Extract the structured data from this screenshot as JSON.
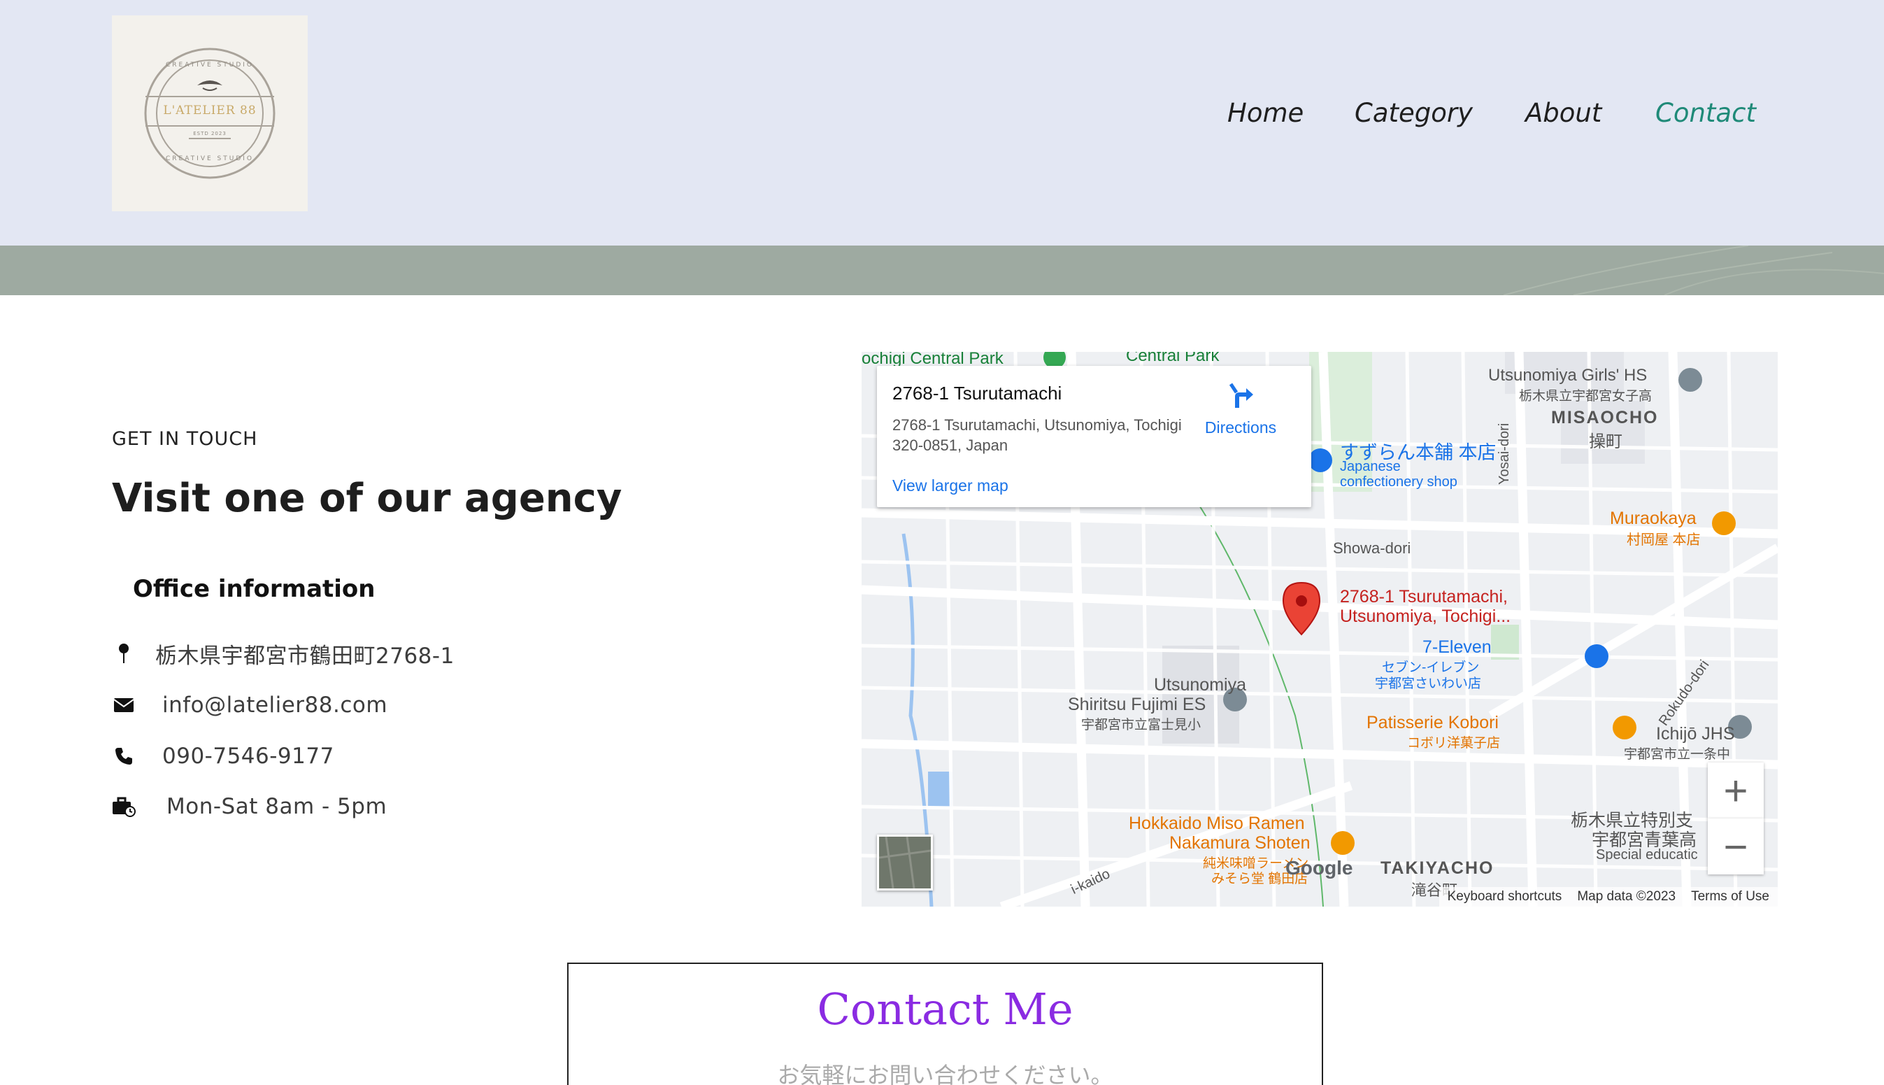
{
  "header": {
    "logo": {
      "top_text": "CREATIVE STUDIO",
      "name": "L'ATELIER 88",
      "est": "ESTD 2023",
      "bottom_text": "CREATIVE STUDIO"
    },
    "nav": [
      {
        "label": "Home",
        "active": false
      },
      {
        "label": "Category",
        "active": false
      },
      {
        "label": "About",
        "active": false
      },
      {
        "label": "Contact",
        "active": true
      }
    ],
    "accent_color": "#1f8a78"
  },
  "contact_section": {
    "eyebrow": "GET IN TOUCH",
    "heading": "Visit one of our agency",
    "subheading": "Office information",
    "items": [
      {
        "icon": "map-pin-icon",
        "text": "栃木県宇都宮市鶴田町2768-1"
      },
      {
        "icon": "envelope-icon",
        "text": "info@latelier88.com"
      },
      {
        "icon": "phone-icon",
        "text": "090-7546-9177"
      },
      {
        "icon": "briefcase-clock-icon",
        "text": "Mon-Sat 8am - 5pm"
      }
    ]
  },
  "map": {
    "card": {
      "title": "2768-1 Tsurutamachi",
      "address": "2768-1 Tsurutamachi, Utsunomiya, Tochigi 320-0851, Japan",
      "directions": "Directions",
      "larger_map": "View larger map"
    },
    "pin_label_1": "2768-1 Tsurutamachi,",
    "pin_label_2": "Utsunomiya, Tochigi...",
    "places": {
      "central_park_left": "ochigi Central Park",
      "central_park": "Central Park",
      "girls_hs": "Utsunomiya Girls' HS",
      "girls_hs_jp": "栃木県立宇都宮女子高",
      "misaocho": "MISAOCHO",
      "misaocho_jp": "操町",
      "suzuran": "すずらん本舗 本店",
      "suzuran_sub1": "Japanese",
      "suzuran_sub2": "confectionery shop",
      "yosai": "Yosai-dori",
      "muraokaya": "Muraokaya",
      "muraokaya_jp": "村岡屋 本店",
      "showa": "Showa-dori",
      "seven": "7-Eleven",
      "seven_jp1": "セブン-イレブン",
      "seven_jp2": "宇都宮さいわい店",
      "fujimi_1": "Utsunomiya",
      "fujimi_2": "Shiritsu Fujimi ES",
      "fujimi_jp": "宇都宮市立富士見小",
      "rokudo": "Rokudo-dori",
      "kobori": "Patisserie Kobori",
      "kobori_jp": "コボリ洋菓子店",
      "ichijo": "Ichijō JHS",
      "ichijo_jp": "宇都宮市立一条中",
      "special_1": "栃木県立特別支",
      "special_2": "宇都宮青葉高",
      "special_3": "Special educatic",
      "hokkaido_1": "Hokkaido Miso Ramen",
      "hokkaido_2": "Nakamura Shoten",
      "hokkaido_jp1": "純米味噌ラーメン",
      "hokkaido_jp2": "みそら堂 鶴田店",
      "takiyacho": "TAKIYACHO",
      "takiyacho_jp": "滝谷町",
      "kaido": "i-kaido",
      "google": "Google"
    },
    "zoom_in": "+",
    "zoom_out": "−",
    "footer": [
      "Keyboard shortcuts",
      "Map data ©2023",
      "Terms of Use"
    ]
  },
  "contact_form": {
    "title": "Contact Me",
    "subtitle": "お気軽にお問い合わせください。"
  }
}
